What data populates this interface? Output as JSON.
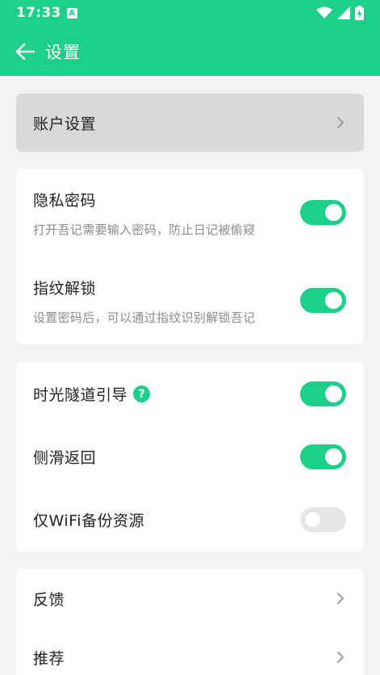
{
  "status_bar": {
    "time": "17:33",
    "notification_icon_text": "A"
  },
  "header": {
    "title": "设置"
  },
  "account": {
    "label": "账户设置"
  },
  "privacy": {
    "password": {
      "label": "隐私密码",
      "desc": "打开吾记需要输入密码，防止日记被偷窥",
      "enabled": true
    },
    "fingerprint": {
      "label": "指纹解锁",
      "desc": "设置密码后，可以通过指纹识别解锁吾记",
      "enabled": true
    }
  },
  "general": {
    "time_tunnel": {
      "label": "时光隧道引导",
      "help": "?",
      "enabled": true
    },
    "swipe_back": {
      "label": "侧滑返回",
      "enabled": true
    },
    "wifi_backup": {
      "label": "仅WiFi备份资源",
      "enabled": false
    }
  },
  "more": {
    "feedback": {
      "label": "反馈"
    },
    "recommend": {
      "label": "推荐"
    }
  },
  "colors": {
    "accent": "#1ecf8a",
    "background": "#f2f3f5"
  }
}
